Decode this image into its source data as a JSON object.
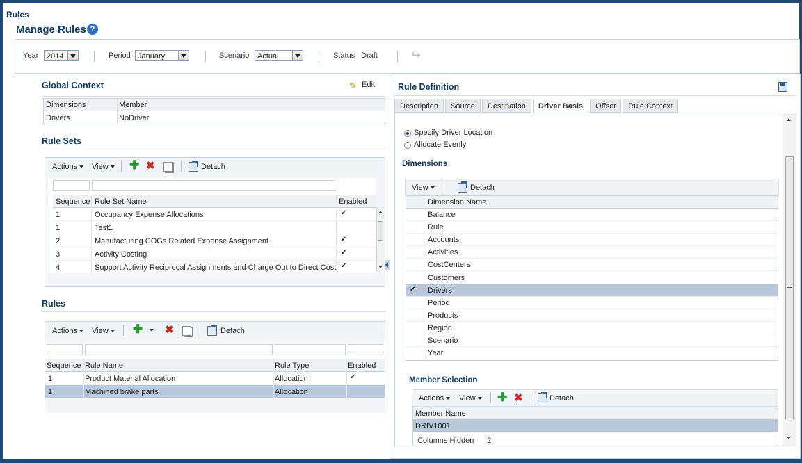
{
  "page": {
    "title": "Rules",
    "heading": "Manage Rules",
    "help_glyph": "?"
  },
  "pov": {
    "year_label": "Year",
    "year_value": "2014",
    "period_label": "Period",
    "period_value": "January",
    "scenario_label": "Scenario",
    "scenario_value": "Actual",
    "status_label": "Status",
    "status_value": "Draft"
  },
  "global_context": {
    "title": "Global Context",
    "edit_label": "Edit",
    "columns": [
      "Dimensions",
      "Member"
    ],
    "rows": [
      {
        "dimension": "Drivers",
        "member": "NoDriver"
      }
    ]
  },
  "rule_sets": {
    "title": "Rule Sets",
    "toolbar": {
      "actions": "Actions",
      "view": "View",
      "detach": "Detach"
    },
    "columns": [
      "Sequence",
      "Rule Set Name",
      "Enabled"
    ],
    "rows": [
      {
        "seq": "1",
        "name": "Occupancy Expense Allocations",
        "enabled": "✔"
      },
      {
        "seq": "1",
        "name": "Test1",
        "enabled": ""
      },
      {
        "seq": "2",
        "name": "Manufacturing COGs Related Expense Assignment",
        "enabled": "✔"
      },
      {
        "seq": "3",
        "name": "Activity Costing",
        "enabled": "✔"
      },
      {
        "seq": "4",
        "name": "Support Activity Reciprocal Assignments and Charge Out to Direct Cost C",
        "enabled": "✔"
      }
    ]
  },
  "rules": {
    "title": "Rules",
    "toolbar": {
      "actions": "Actions",
      "view": "View",
      "detach": "Detach"
    },
    "columns": [
      "Sequence",
      "Rule Name",
      "Rule Type",
      "Enabled"
    ],
    "rows": [
      {
        "seq": "1",
        "name": "Product Material Allocation",
        "type": "Allocation",
        "enabled": "✔"
      },
      {
        "seq": "1",
        "name": "Machined brake parts",
        "type": "Allocation",
        "enabled": ""
      }
    ]
  },
  "rule_definition": {
    "title": "Rule Definition",
    "tabs": [
      "Description",
      "Source",
      "Destination",
      "Driver Basis",
      "Offset",
      "Rule Context"
    ],
    "active_tab": "Driver Basis",
    "radio_specify": "Specify Driver Location",
    "radio_evenly": "Allocate Evenly",
    "dimensions_title": "Dimensions",
    "dim_toolbar": {
      "view": "View",
      "detach": "Detach"
    },
    "dim_column": "Dimension Name",
    "dimensions": [
      "Balance",
      "Rule",
      "Accounts",
      "Activities",
      "CostCenters",
      "Customers",
      "Drivers",
      "Period",
      "Products",
      "Region",
      "Scenario",
      "Year"
    ],
    "member_title": "Member Selection",
    "member_toolbar": {
      "actions": "Actions",
      "view": "View",
      "detach": "Detach"
    },
    "member_column": "Member Name",
    "member_value": "DRIV1001",
    "columns_hidden_label": "Columns Hidden",
    "columns_hidden_value": "2"
  },
  "colors": {
    "title_blue": "#0f3b63",
    "border_blue": "#1f4a78",
    "selected_row": "#b8c8da"
  }
}
